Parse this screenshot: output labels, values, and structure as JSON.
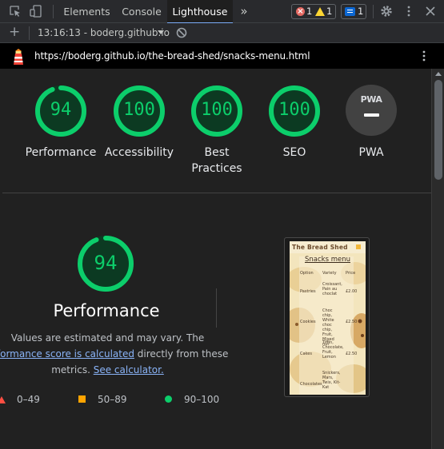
{
  "tabs": [
    {
      "label": "Elements",
      "active": false
    },
    {
      "label": "Console",
      "active": false
    },
    {
      "label": "Lighthouse",
      "active": true
    }
  ],
  "tabbar": {
    "more_tabs_glyph": "»",
    "error_count": "1",
    "warning_count": "1",
    "message_count": "1"
  },
  "reportbar": {
    "add_glyph": "+",
    "report_label": "13:16:13 - boderg.github.io"
  },
  "url": "https://boderg.github.io/the-bread-shed/snacks-menu.html",
  "scores": [
    {
      "value": "94",
      "label": "Performance",
      "score": 0.94
    },
    {
      "value": "100",
      "label": "Accessibility",
      "score": 1.0
    },
    {
      "value": "100",
      "label": "Best\nPractices",
      "score": 1.0
    },
    {
      "value": "100",
      "label": "SEO",
      "score": 1.0
    },
    {
      "value": "PWA",
      "label": "PWA",
      "score": null
    }
  ],
  "performance": {
    "score": "94",
    "title": "Performance",
    "desc_line1": "Values are estimated and may vary. The",
    "desc_link1": "erformance score is calculated",
    "desc_line2_rest": " directly from these",
    "desc_line3_pre": "metrics. ",
    "desc_link2": "See calculator.",
    "legend": [
      {
        "range": "0–49",
        "shape": "triangle",
        "color": "#ff4e42"
      },
      {
        "range": "50–89",
        "shape": "square",
        "color": "#ffa400"
      },
      {
        "range": "90–100",
        "shape": "circle",
        "color": "#0cce6b"
      }
    ]
  },
  "screenshot": {
    "brand": "The Bread Shed",
    "heading": "Snacks menu",
    "columns": [
      "Option",
      "Variety",
      "Price"
    ],
    "rows": [
      {
        "option": "Pastries",
        "variety": "Croissant, Pain au choclat",
        "price": "£2.00"
      },
      {
        "option": "Cookies",
        "variety": "Choc chip, White choc chip, Fruit, Mixed nut",
        "price": "£2.50"
      },
      {
        "option": "Cakes",
        "variety": "Tiffin, Chocolate, Fruit, Lemon",
        "price": "£2.50"
      },
      {
        "option": "Chocolates",
        "variety": "Snickers, Mars, Twix, Kit-Kat",
        "price": ""
      }
    ]
  },
  "colors": {
    "good": "#0cce6b",
    "good_bg": "#0c3a22",
    "pwa_bg": "#424242",
    "link": "#8ab4f8"
  }
}
